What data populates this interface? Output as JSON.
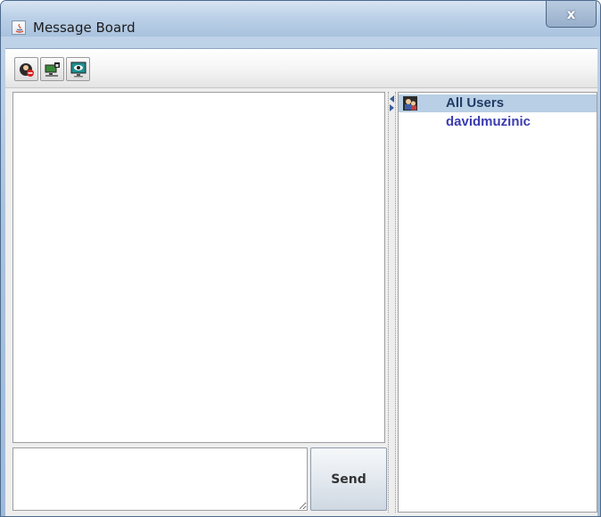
{
  "window": {
    "title": "Message Board",
    "close_label": "x"
  },
  "toolbar": {
    "buttons": [
      {
        "icon": "logout-avatar-icon"
      },
      {
        "icon": "computer-lock-icon"
      },
      {
        "icon": "monitor-view-icon"
      }
    ]
  },
  "chat": {
    "messages": [],
    "input_value": "",
    "send_label": "Send"
  },
  "users": {
    "items": [
      {
        "label": "All Users",
        "icon": "users-group-icon",
        "selected": true
      },
      {
        "label": "davidmuzinic",
        "selected": false
      }
    ]
  },
  "colors": {
    "selection": "#b8cfe5",
    "user_text": "#3b3bb0",
    "accent": "#3a5f9a"
  }
}
